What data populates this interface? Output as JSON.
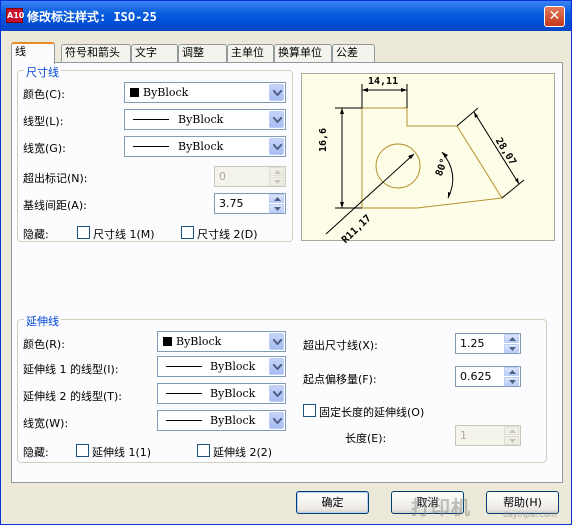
{
  "window": {
    "title": "修改标注样式: ISO-25",
    "icon": "A10",
    "close": "✕"
  },
  "tabs": [
    "线",
    "符号和箭头",
    "文字",
    "调整",
    "主单位",
    "换算单位",
    "公差"
  ],
  "dimlines": {
    "title": "尺寸线",
    "color_label": "颜色(C):",
    "color_value": "ByBlock",
    "linetype_label": "线型(L):",
    "linetype_value": "ByBlock",
    "lineweight_label": "线宽(G):",
    "lineweight_value": "ByBlock",
    "extend_label": "超出标记(N):",
    "extend_value": "0",
    "baseline_label": "基线间距(A):",
    "baseline_value": "3.75",
    "suppress_label": "隐藏:",
    "suppress1": "尺寸线 1(M)",
    "suppress2": "尺寸线 2(D)"
  },
  "extlines": {
    "title": "延伸线",
    "color_label": "颜色(R):",
    "color_value": "ByBlock",
    "lt1_label": "延伸线 1 的线型(I):",
    "lt1_value": "ByBlock",
    "lt2_label": "延伸线 2 的线型(T):",
    "lt2_value": "ByBlock",
    "lw_label": "线宽(W):",
    "lw_value": "ByBlock",
    "suppress_label": "隐藏:",
    "suppress1": "延伸线 1(1)",
    "suppress2": "延伸线 2(2)",
    "beyond_label": "超出尺寸线(X):",
    "beyond_value": "1.25",
    "offset_label": "起点偏移量(F):",
    "offset_value": "0.625",
    "fixed_label": "固定长度的延伸线(O)",
    "length_label": "长度(E):",
    "length_value": "1"
  },
  "preview": {
    "dim_top": "14,11",
    "dim_left": "16,6",
    "dim_right": "28,07",
    "dim_angle": "80°",
    "dim_radius": "R11,17"
  },
  "buttons": {
    "ok": "确定",
    "cancel": "取消",
    "help": "帮助(H)"
  },
  "watermark": {
    "main": "打印机",
    "sub": "dayinpai.com"
  }
}
